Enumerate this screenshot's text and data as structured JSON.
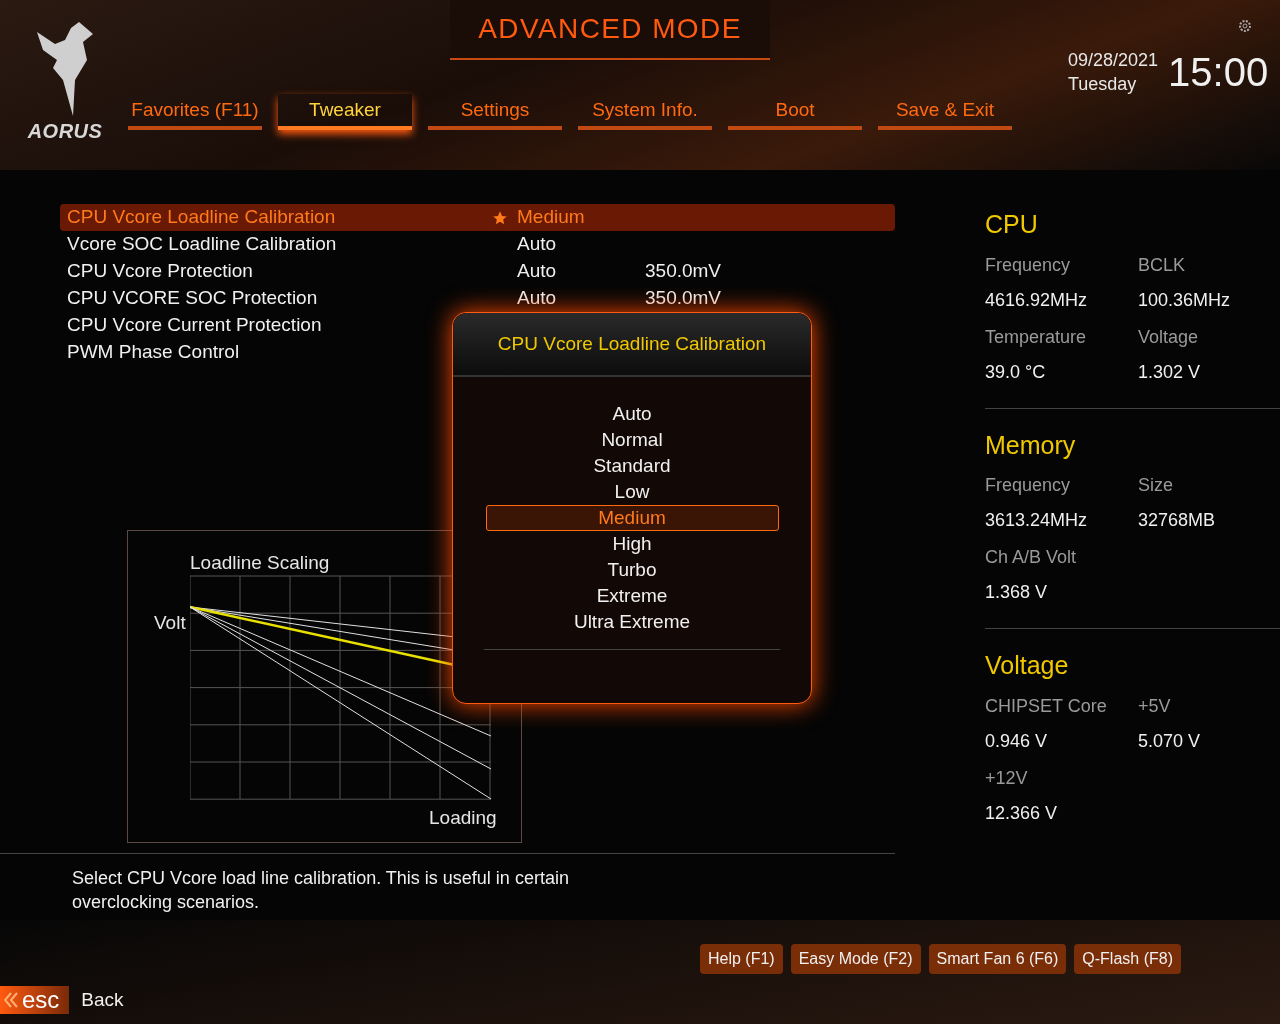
{
  "header": {
    "title": "ADVANCED MODE",
    "logo": "AORUS",
    "date": "09/28/2021",
    "day": "Tuesday",
    "time": "15:00"
  },
  "tabs": [
    {
      "label": "Favorites (F11)",
      "selected": false
    },
    {
      "label": "Tweaker",
      "selected": true
    },
    {
      "label": "Settings",
      "selected": false
    },
    {
      "label": "System Info.",
      "selected": false
    },
    {
      "label": "Boot",
      "selected": false
    },
    {
      "label": "Save & Exit",
      "selected": false
    }
  ],
  "settings": [
    {
      "label": "CPU Vcore Loadline Calibration",
      "value": "Medium",
      "selected": true,
      "starred": true
    },
    {
      "label": "Vcore SOC Loadline Calibration",
      "value": "Auto",
      "selected": false,
      "starred": false
    },
    {
      "label": "CPU Vcore Protection",
      "value": "Auto",
      "reading": "350.0mV",
      "selected": false,
      "starred": false
    },
    {
      "label": "CPU VCORE SOC Protection",
      "value": "Auto",
      "reading": "350.0mV",
      "selected": false,
      "starred": false
    },
    {
      "label": "CPU Vcore Current Protection",
      "selected": false,
      "starred": false
    },
    {
      "label": "PWM Phase Control",
      "selected": false,
      "starred": false
    }
  ],
  "popup": {
    "title": "CPU Vcore Loadline Calibration",
    "options": [
      {
        "label": "Auto",
        "selected": false
      },
      {
        "label": "Normal",
        "selected": false
      },
      {
        "label": "Standard",
        "selected": false
      },
      {
        "label": "Low",
        "selected": false
      },
      {
        "label": "Medium",
        "selected": true
      },
      {
        "label": "High",
        "selected": false
      },
      {
        "label": "Turbo",
        "selected": false
      },
      {
        "label": "Extreme",
        "selected": false
      },
      {
        "label": "Ultra Extreme",
        "selected": false
      }
    ]
  },
  "graph": {
    "title": "Loadline Scaling",
    "y_label": "Volt",
    "x_label": "Loading"
  },
  "description": "Select CPU Vcore load line calibration. This is useful in certain overclocking scenarios.",
  "monitor": [
    {
      "title": "CPU",
      "items": [
        {
          "label": "Frequency",
          "value": "4616.92MHz"
        },
        {
          "label": "BCLK",
          "value": "100.36MHz"
        },
        {
          "label": "Temperature",
          "value": "39.0 °C"
        },
        {
          "label": "Voltage",
          "value": "1.302 V"
        }
      ]
    },
    {
      "title": "Memory",
      "items": [
        {
          "label": "Frequency",
          "value": "3613.24MHz"
        },
        {
          "label": "Size",
          "value": "32768MB"
        },
        {
          "label": "Ch A/B Volt",
          "value": "1.368 V"
        }
      ]
    },
    {
      "title": "Voltage",
      "items": [
        {
          "label": "CHIPSET Core",
          "value": "0.946 V"
        },
        {
          "label": "+5V",
          "value": "5.070 V"
        },
        {
          "label": "+12V",
          "value": "12.366 V"
        }
      ]
    }
  ],
  "footer_buttons": [
    "Help (F1)",
    "Easy Mode (F2)",
    "Smart Fan 6 (F6)",
    "Q-Flash (F8)"
  ],
  "back": {
    "key": "esc",
    "label": "Back"
  }
}
